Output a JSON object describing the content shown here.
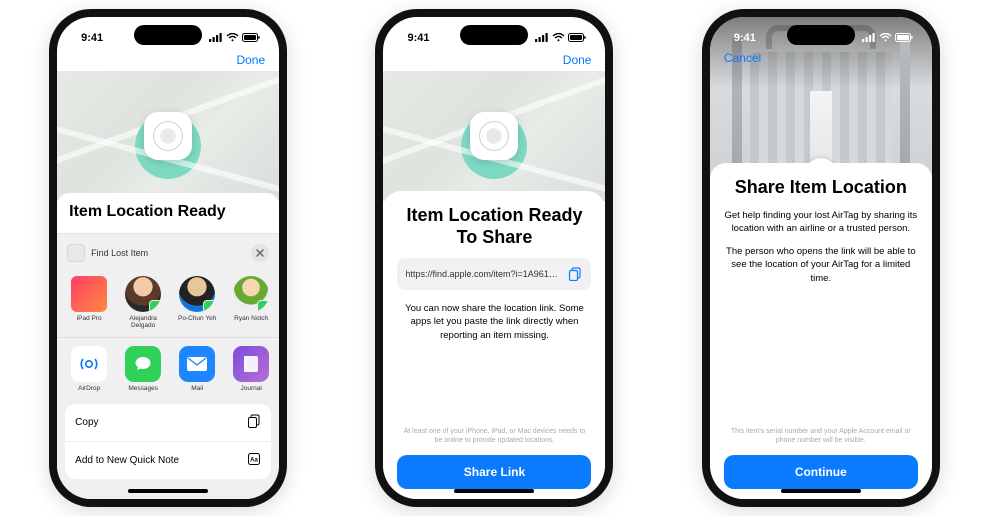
{
  "status": {
    "time": "9:41"
  },
  "phone1": {
    "done": "Done",
    "header_title": "Item Location Ready",
    "share_item_title": "Find Lost Item",
    "contacts": [
      {
        "name": "iPad Pro"
      },
      {
        "name": "Alejandra Delgado"
      },
      {
        "name": "Po-Chun Yeh"
      },
      {
        "name": "Ryan Notch"
      }
    ],
    "apps": [
      {
        "name": "AirDrop"
      },
      {
        "name": "Messages"
      },
      {
        "name": "Mail"
      },
      {
        "name": "Journal"
      }
    ],
    "actions": {
      "copy": "Copy",
      "quicknote": "Add to New Quick Note"
    }
  },
  "phone2": {
    "done": "Done",
    "title": "Item Location Ready To Share",
    "link": "https://find.apple.com/item?i=1A961…",
    "desc": "You can now share the location link. Some apps let you paste the link directly when reporting an item missing.",
    "fine": "At least one of your iPhone, iPad, or Mac devices needs to be online to provide updated locations.",
    "button": "Share Link"
  },
  "phone3": {
    "cancel": "Cancel",
    "title": "Share Item Location",
    "desc1": "Get help finding your lost AirTag by sharing its location with an airline or a trusted person.",
    "desc2": "The person who opens the link will be able to see the location of your AirTag for a limited time.",
    "fine": "This item's serial number and your Apple Account email or phone number will be visible.",
    "button": "Continue"
  }
}
